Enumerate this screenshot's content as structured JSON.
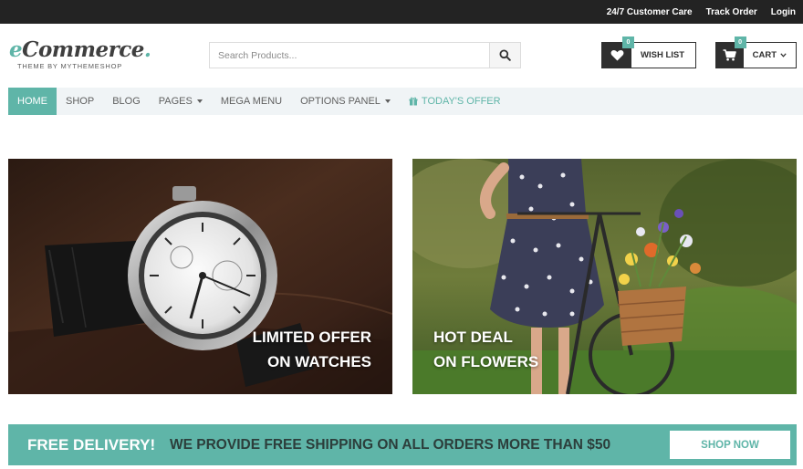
{
  "topbar": {
    "links": [
      "24/7 Customer Care",
      "Track Order",
      "Login"
    ]
  },
  "logo": {
    "brand_e": "e",
    "brand_rest": "Commerce",
    "brand_dot": ".",
    "tagline": "THEME BY MYTHEMESHOP"
  },
  "search": {
    "placeholder": "Search Products...",
    "icon": "search-icon"
  },
  "wishlist": {
    "label": "WISH LIST",
    "count": "0",
    "icon": "heart-icon"
  },
  "cart": {
    "label": "CART",
    "count": "0",
    "icon": "cart-icon"
  },
  "nav": {
    "items": [
      {
        "label": "HOME"
      },
      {
        "label": "SHOP"
      },
      {
        "label": "BLOG"
      },
      {
        "label": "PAGES"
      },
      {
        "label": "MEGA MENU"
      },
      {
        "label": "OPTIONS PANEL"
      },
      {
        "label": "TODAY'S OFFER"
      }
    ]
  },
  "banners": [
    {
      "line1": "LIMITED OFFER",
      "line2": "ON WATCHES"
    },
    {
      "line1": "HOT DEAL",
      "line2": "ON FLOWERS"
    }
  ],
  "delivery": {
    "title": "FREE DELIVERY!",
    "text": "WE PROVIDE FREE SHIPPING ON ALL ORDERS MORE THAN $50",
    "button": "SHOP NOW"
  },
  "colors": {
    "accent": "#5fb5a8",
    "topbar": "#232323",
    "dark": "#2f2f2f"
  }
}
